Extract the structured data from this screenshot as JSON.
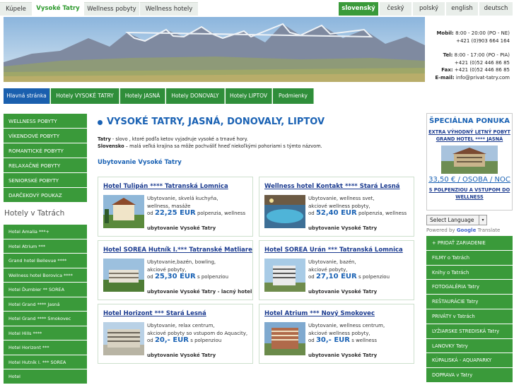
{
  "top_tabs": [
    {
      "label": "Kúpele",
      "active": false
    },
    {
      "label": "Vysoké Tatry",
      "active": true
    },
    {
      "label": "Wellness pobyty",
      "active": false
    },
    {
      "label": "Wellness hotely",
      "active": false
    }
  ],
  "languages": [
    {
      "label": "slovenský",
      "active": true
    },
    {
      "label": "český",
      "active": false
    },
    {
      "label": "polský",
      "active": false
    },
    {
      "label": "english",
      "active": false
    },
    {
      "label": "deutsch",
      "active": false
    }
  ],
  "contact": {
    "mobil_label": "Mobil:",
    "mobil_hours": "8:00 - 20:00 (PO - NE)",
    "mobil_phone": "+421 (0)903 664 164",
    "tel_label": "Tel:",
    "tel_hours": "8:00 - 17:00 (PO - PIA)",
    "tel_phone": "+421 (0)52 446 86 85",
    "fax_label": "Fax:",
    "fax": "+421 (0)52 446 86 85",
    "email_label": "E-mail:",
    "email": "info@privat-tatry.com"
  },
  "main_menu": [
    {
      "label": "Hlavná stránka",
      "active": true
    },
    {
      "label": "Hotely VYSOKÉ TATRY",
      "active": false
    },
    {
      "label": "Hotely JASNÁ",
      "active": false
    },
    {
      "label": "Hotely DONOVALY",
      "active": false
    },
    {
      "label": "Hotely LIPTOV",
      "active": false
    },
    {
      "label": "Podmienky",
      "active": false
    }
  ],
  "left_links": [
    "WELLNESS POBYTY",
    "VÍKENDOVÉ POBYTY",
    "ROMANTICKÉ POBYTY",
    "RELAXAČNÉ POBYTY",
    "SENIORSKÉ POBYTY",
    "DARČEKOVÝ POUKAZ"
  ],
  "left_hotels_title": "Hotely v Tatrách",
  "left_hotels": [
    "Hotel Amalia ***+",
    "Hotel Atrium ***",
    "Grand hotel Bellevue ****",
    "Wellness hotel Borovica ****",
    "Hotel Ďumbier ** SOREA",
    "Hotel Grand **** Jasná",
    "Hotel Grand **** Smokovec",
    "Hotel Hills ****",
    "Hotel Horizont ***",
    "Hotel Hutník I. *** SOREA",
    "Hotel"
  ],
  "main": {
    "title": "VYSOKÉ TATRY, JASNÁ, DONOVALY, LIPTOV",
    "intro1_bold": "Tatry",
    "intro1": " - slovo , ktoré podľa ketov vyjadruje vysoké a trnavé hory.",
    "intro2_bold": "Slovensko",
    "intro2": " – malá veľká krajina sa môže pochváliť hneď niekoľkými pohoriami s týmto názvom.",
    "subtitle": "Ubytovanie Vysoké Tatry"
  },
  "cards": [
    {
      "title": "Hotel Tulipán **** Tatranská Lomnica",
      "desc": "Ubytovanie, skvelá kuchyňa,\nwellness, masáže",
      "price_prefix": "od",
      "price": "22,25 EUR",
      "price_suffix": " polpenzia, wellness",
      "link": "ubytovanie Vysoké Tatry"
    },
    {
      "title": "Wellness hotel Kontakt **** Stará Lesná",
      "desc": "Ubytovanie, wellness svet,\nakciové wellness pobyty,",
      "price_prefix": "od",
      "price": "52,40 EUR",
      "price_suffix": " polpenzia, wellness",
      "link": "ubytovanie Vysoké Tatry"
    },
    {
      "title": "Hotel SOREA Hutník I.*** Tatranské Matliare",
      "desc": "Ubytovanie,bazén, bowling,\nakciové pobyty,",
      "price_prefix": "od",
      "price": "25,30 EUR",
      "price_suffix": " s polpenziou",
      "link": "ubytovanie Vysoké Tatry - lacný hotel"
    },
    {
      "title": "Hotel SOREA Urán *** Tatranská Lomnica",
      "desc": "Ubytovanie, bazén,\nakciové pobyty,",
      "price_prefix": "od",
      "price": "27,10 EUR",
      "price_suffix": " s polpenziou",
      "link": "ubytovanie Vysoké Tatry"
    },
    {
      "title": "Hotel Horizont *** Stará Lesná",
      "desc": "Ubytovanie, relax centrum,\nakciové pobyty so vstupom do Aquacity,",
      "price_prefix": "od",
      "price": "20,- EUR",
      "price_suffix": " s polpenziou",
      "link": "ubytovanie Vysoké Tatry"
    },
    {
      "title": "Hotel Atrium *** Nový Smokovec",
      "desc": "Ubytovanie, wellness centrum,\nakciové wellness pobyty,",
      "price_prefix": "od",
      "price": "30,- EUR",
      "price_suffix": " s wellness",
      "link": "ubytovanie Vysoké Tatry"
    }
  ],
  "special": {
    "title": "ŠPECIÁLNA PONUKA",
    "line1": "EXTRA VÝHODNÝ LETNÝ POBYT",
    "line2": "GRAND HOTEL **** JASNÁ",
    "price": "33,50 € / OSOBA / NOC",
    "note": "S POLPENZIOU A VSTUPOM DO WELLNESS"
  },
  "translate": {
    "select": "Select Language",
    "powered": "Powered by",
    "brand": "Google",
    "tr": "Translate"
  },
  "right_links": [
    "+ PRIDAŤ ZARIADENIE",
    "FILMY o Tatrách",
    "Knihy o Tatrách",
    "FOTOGALÉRIA Tatry",
    "REŠTAURÁCIE Tatry",
    "PRIVÁTY v Tatrách",
    "LYŽIARSKE STREDISKÁ Tatry",
    "LANOVKY Tatry",
    "KÚPALISKÁ - AQUAPARKY",
    "DOPRAVA v Tatry"
  ]
}
